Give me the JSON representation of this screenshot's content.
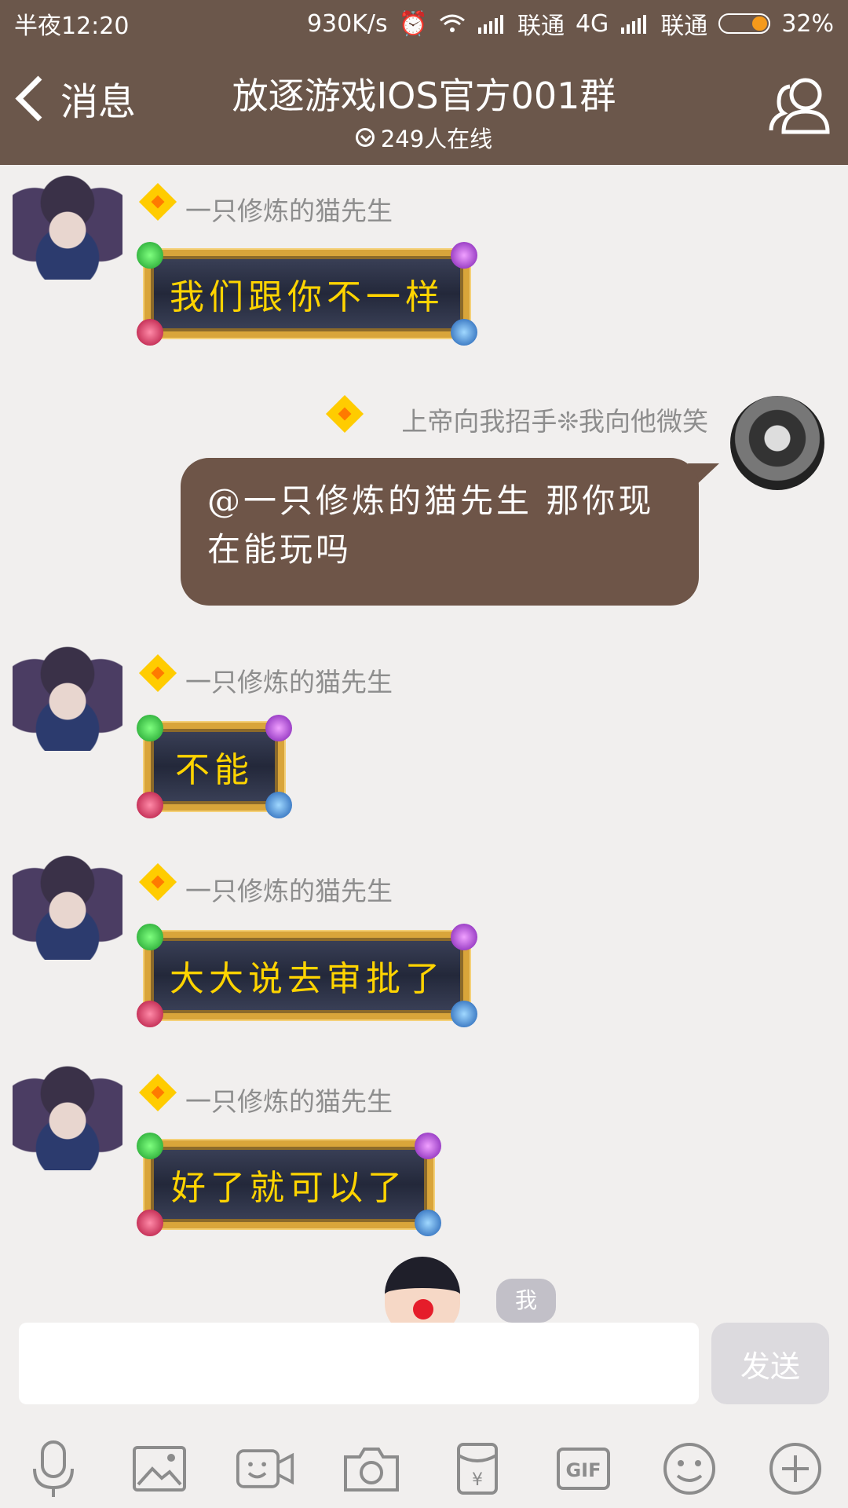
{
  "status_bar": {
    "time": "半夜12:20",
    "net_speed": "930K/s",
    "carrier1": "联通",
    "network": "4G",
    "carrier2": "联通",
    "battery": "32%",
    "battery_level": 0.32
  },
  "header": {
    "back_label": "消息",
    "title": "放逐游戏IOS官方001群",
    "online_count": "249人在线"
  },
  "messages": [
    {
      "sender": "一只修炼的猫先生",
      "text": "我们跟你不一样",
      "side": "left"
    },
    {
      "sender": "上帝向我招手❊我向他微笑",
      "text": "@一只修炼的猫先生 那你现在能玩吗",
      "side": "right"
    },
    {
      "sender": "一只修炼的猫先生",
      "text": "不能",
      "side": "left"
    },
    {
      "sender": "一只修炼的猫先生",
      "text": "大大说去审批了",
      "side": "left"
    },
    {
      "sender": "一只修炼的猫先生",
      "text": "好了就可以了",
      "side": "left"
    }
  ],
  "me_tag": "我",
  "composer": {
    "input_value": "",
    "send_label": "发送"
  },
  "toolbar_icons": [
    "microphone-icon",
    "image-icon",
    "video-call-icon",
    "camera-icon",
    "red-packet-icon",
    "gif-icon",
    "emoji-icon",
    "plus-icon"
  ],
  "colors": {
    "header": "#6b574b",
    "bubble_brown": "#6e5548",
    "background": "#f1efee",
    "fancy_text": "#ffd400"
  }
}
